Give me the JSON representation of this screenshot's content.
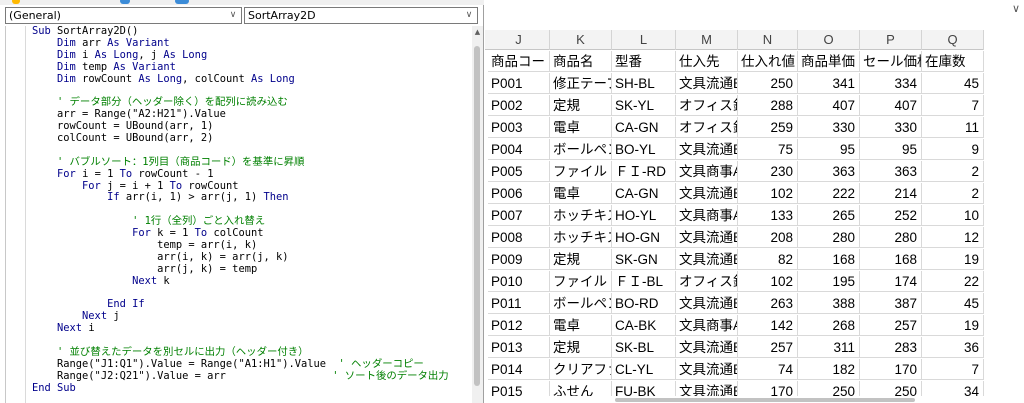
{
  "vbe": {
    "object_combo": "(General)",
    "procedure_combo": "SortArray2D",
    "code_lines": [
      [
        [
          "kw",
          "Sub "
        ],
        [
          "t",
          "SortArray2D()"
        ]
      ],
      [
        [
          "t",
          "    "
        ],
        [
          "kw",
          "Dim "
        ],
        [
          "t",
          "arr "
        ],
        [
          "kw",
          "As Variant"
        ]
      ],
      [
        [
          "t",
          "    "
        ],
        [
          "kw",
          "Dim "
        ],
        [
          "t",
          "i "
        ],
        [
          "kw",
          "As Long"
        ],
        [
          "t",
          ", j "
        ],
        [
          "kw",
          "As Long"
        ]
      ],
      [
        [
          "t",
          "    "
        ],
        [
          "kw",
          "Dim "
        ],
        [
          "t",
          "temp "
        ],
        [
          "kw",
          "As Variant"
        ]
      ],
      [
        [
          "t",
          "    "
        ],
        [
          "kw",
          "Dim "
        ],
        [
          "t",
          "rowCount "
        ],
        [
          "kw",
          "As Long"
        ],
        [
          "t",
          ", colCount "
        ],
        [
          "kw",
          "As Long"
        ]
      ],
      [
        [
          "t",
          ""
        ]
      ],
      [
        [
          "cm",
          "    ' データ部分（ヘッダー除く）を配列に読み込む"
        ]
      ],
      [
        [
          "t",
          "    arr = Range(\"A2:H21\").Value"
        ]
      ],
      [
        [
          "t",
          "    rowCount = UBound(arr, 1)"
        ]
      ],
      [
        [
          "t",
          "    colCount = UBound(arr, 2)"
        ]
      ],
      [
        [
          "t",
          ""
        ]
      ],
      [
        [
          "cm",
          "    ' バブルソート：1列目（商品コード）を基準に昇順"
        ]
      ],
      [
        [
          "t",
          "    "
        ],
        [
          "kw",
          "For "
        ],
        [
          "t",
          "i = 1 "
        ],
        [
          "kw",
          "To "
        ],
        [
          "t",
          "rowCount - 1"
        ]
      ],
      [
        [
          "t",
          "        "
        ],
        [
          "kw",
          "For "
        ],
        [
          "t",
          "j = i + 1 "
        ],
        [
          "kw",
          "To "
        ],
        [
          "t",
          "rowCount"
        ]
      ],
      [
        [
          "t",
          "            "
        ],
        [
          "kw",
          "If "
        ],
        [
          "t",
          "arr(i, 1) > arr(j, 1) "
        ],
        [
          "kw",
          "Then"
        ]
      ],
      [
        [
          "t",
          ""
        ]
      ],
      [
        [
          "cm",
          "                ' 1行（全列）ごと入れ替え"
        ]
      ],
      [
        [
          "t",
          "                "
        ],
        [
          "kw",
          "For "
        ],
        [
          "t",
          "k = 1 "
        ],
        [
          "kw",
          "To "
        ],
        [
          "t",
          "colCount"
        ]
      ],
      [
        [
          "t",
          "                    temp = arr(i, k)"
        ]
      ],
      [
        [
          "t",
          "                    arr(i, k) = arr(j, k)"
        ]
      ],
      [
        [
          "t",
          "                    arr(j, k) = temp"
        ]
      ],
      [
        [
          "t",
          "                "
        ],
        [
          "kw",
          "Next "
        ],
        [
          "t",
          "k"
        ]
      ],
      [
        [
          "t",
          ""
        ]
      ],
      [
        [
          "t",
          "            "
        ],
        [
          "kw",
          "End If"
        ]
      ],
      [
        [
          "t",
          "        "
        ],
        [
          "kw",
          "Next "
        ],
        [
          "t",
          "j"
        ]
      ],
      [
        [
          "t",
          "    "
        ],
        [
          "kw",
          "Next "
        ],
        [
          "t",
          "i"
        ]
      ],
      [
        [
          "t",
          ""
        ]
      ],
      [
        [
          "cm",
          "    ' 並び替えたデータを別セルに出力（ヘッダー付き）"
        ]
      ],
      [
        [
          "t",
          "    Range(\"J1:Q1\").Value = Range(\"A1:H1\").Value  "
        ],
        [
          "cm",
          "' ヘッダーコピー"
        ]
      ],
      [
        [
          "t",
          "    Range(\"J2:Q21\").Value = arr                 "
        ],
        [
          "cm",
          "' ソート後のデータ出力"
        ]
      ],
      [
        [
          "kw",
          "End Sub"
        ]
      ]
    ]
  },
  "excel": {
    "columns": [
      "J",
      "K",
      "L",
      "M",
      "N",
      "O",
      "P",
      "Q"
    ],
    "headers": [
      "商品コード",
      "商品名",
      "型番",
      "仕入先",
      "仕入れ値",
      "商品単価",
      "セール価格",
      "在庫数"
    ],
    "rows": [
      [
        "P001",
        "修正テープ",
        "SH-BL",
        "文具流通B",
        "250",
        "341",
        "334",
        "45"
      ],
      [
        "P002",
        "定規",
        "SK-YL",
        "オフィス針",
        "288",
        "407",
        "407",
        "7"
      ],
      [
        "P003",
        "電卓",
        "CA-GN",
        "オフィス針",
        "259",
        "330",
        "330",
        "11"
      ],
      [
        "P004",
        "ボールペン",
        "BO-YL",
        "文具流通B",
        "75",
        "95",
        "95",
        "9"
      ],
      [
        "P005",
        "ファイル",
        "ＦＩ-RD",
        "文具商事A",
        "230",
        "363",
        "363",
        "2"
      ],
      [
        "P006",
        "電卓",
        "CA-GN",
        "文具流通B",
        "102",
        "222",
        "214",
        "2"
      ],
      [
        "P007",
        "ホッチキス",
        "HO-YL",
        "文具商事A",
        "133",
        "265",
        "252",
        "10"
      ],
      [
        "P008",
        "ホッチキス",
        "HO-GN",
        "文具流通B",
        "208",
        "280",
        "280",
        "12"
      ],
      [
        "P009",
        "定規",
        "SK-GN",
        "文具流通B",
        "82",
        "168",
        "168",
        "19"
      ],
      [
        "P010",
        "ファイル",
        "ＦＩ-BL",
        "オフィス針",
        "102",
        "195",
        "174",
        "22"
      ],
      [
        "P011",
        "ボールペン",
        "BO-RD",
        "文具流通B",
        "263",
        "388",
        "387",
        "45"
      ],
      [
        "P012",
        "電卓",
        "CA-BK",
        "文具商事A",
        "142",
        "268",
        "257",
        "19"
      ],
      [
        "P013",
        "定規",
        "SK-BL",
        "文具流通B",
        "257",
        "311",
        "283",
        "36"
      ],
      [
        "P014",
        "クリアファ",
        "CL-YL",
        "文具流通B",
        "74",
        "182",
        "170",
        "7"
      ],
      [
        "P015",
        "ふせん",
        "FU-BK",
        "文具流通B",
        "170",
        "250",
        "250",
        "34"
      ]
    ]
  },
  "colors": {
    "keyword": "#00008b",
    "comment": "#008000",
    "header_bg": "#f3f3f3"
  }
}
